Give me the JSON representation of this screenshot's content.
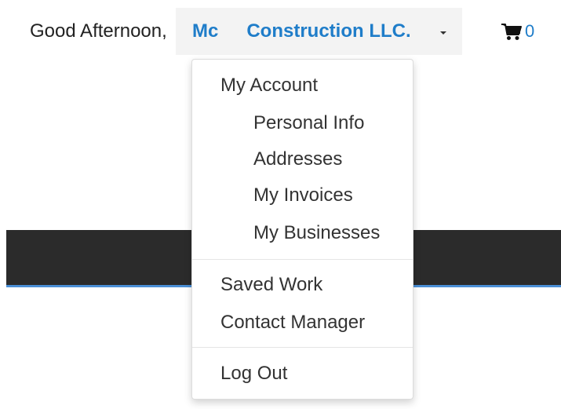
{
  "header": {
    "greeting": "Good Afternoon,",
    "account_name_start": "Mc",
    "account_name_end": "Construction LLC.",
    "cart_count": "0"
  },
  "dropdown": {
    "my_account": "My Account",
    "personal_info": "Personal Info",
    "addresses": "Addresses",
    "my_invoices": "My Invoices",
    "my_businesses": "My Businesses",
    "saved_work": "Saved Work",
    "contact_manager": "Contact Manager",
    "log_out": "Log Out"
  },
  "icons": {
    "cart": "shopping-cart-icon",
    "caret": "caret-down-icon"
  },
  "colors": {
    "link": "#1f7dc9",
    "dark_band": "#2b2b2b",
    "band_accent": "#4a8fd6"
  }
}
